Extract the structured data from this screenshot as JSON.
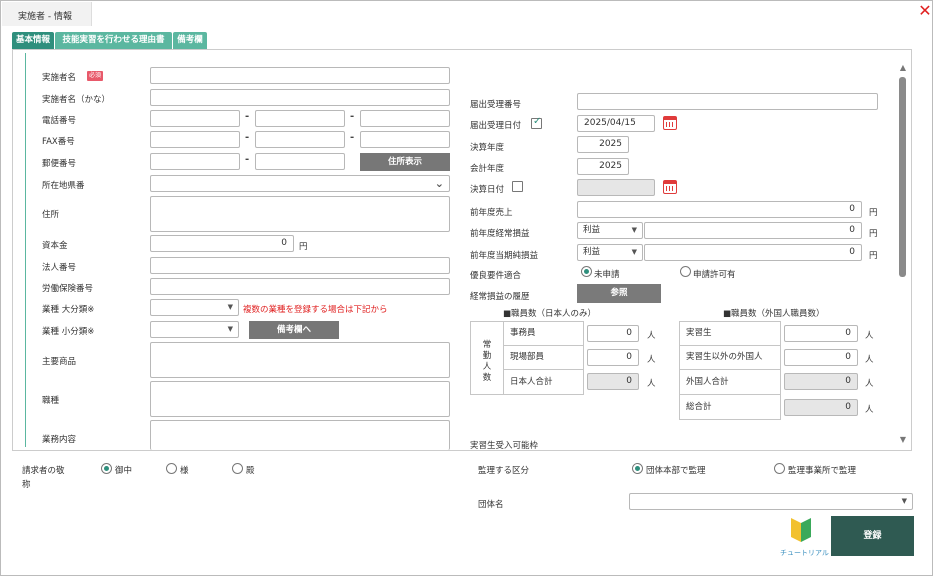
{
  "window": {
    "title": "実施者 - 情報",
    "close": "✕"
  },
  "tabs": [
    {
      "label": "基本情報"
    },
    {
      "label": "技能実習を行わせる理由書"
    },
    {
      "label": "備考欄"
    }
  ],
  "left": {
    "name_label": "実施者名",
    "required_badge": "必須",
    "kana_label": "実施者名（かな）",
    "phone_label": "電話番号",
    "fax_label": "FAX番号",
    "postal_label": "郵便番号",
    "dash": "-",
    "address_btn": "住所表示",
    "pref_label": "所在地県番",
    "address_label": "住所",
    "capital_label": "資本金",
    "capital_value": "0",
    "yen": "円",
    "corp_label": "法人番号",
    "insurance_label": "労働保険番号",
    "ind_major_label": "業種 大分類※",
    "ind_minor_label": "業種 小分類※",
    "warn_text": "複数の業種を登録する場合は下記から",
    "remarks_btn": "備考欄へ",
    "products_label": "主要商品",
    "job_label": "職種",
    "business_label": "業務内容"
  },
  "right": {
    "notif_no_label": "届出受理番号",
    "notif_date_label": "届出受理日付",
    "notif_date_checked": true,
    "notif_date_value": "2025/04/15",
    "fiscal_year_label": "決算年度",
    "fiscal_year_value": "2025",
    "account_year_label": "会計年度",
    "account_year_value": "2025",
    "settle_date_label": "決算日付",
    "settle_date_checked": false,
    "prev_sales_label": "前年度売上",
    "prev_sales_value": "0",
    "prev_ordinary_label": "前年度経常損益",
    "prev_ordinary_select": "利益",
    "prev_ordinary_value": "0",
    "prev_net_label": "前年度当期純損益",
    "prev_net_select": "利益",
    "prev_net_value": "0",
    "excellent_label": "優良要件適合",
    "excellent_opt1": "未申請",
    "excellent_opt2": "申請許可有",
    "history_label": "経常損益の履歴",
    "history_btn": "参照",
    "staff_title": "■職員数（日本人のみ）",
    "staff_side": "常勤人数",
    "staff_rows": [
      {
        "label": "事務員",
        "value": "0"
      },
      {
        "label": "現場部員",
        "value": "0"
      },
      {
        "label": "日本人合計",
        "value": "0"
      }
    ],
    "person_unit": "人",
    "foreign_title": "■職員数（外国人職員数）",
    "foreign_rows": [
      {
        "label": "実習生",
        "value": "0"
      },
      {
        "label": "実習生以外の外国人",
        "value": "0"
      },
      {
        "label": "外国人合計",
        "value": "0"
      },
      {
        "label": "総合計",
        "value": "0"
      }
    ],
    "intake_label": "実習生受入可能枠"
  },
  "bottom": {
    "honorific_label_1": "請求者の敬",
    "honorific_label_2": "称",
    "hon_opt1": "御中",
    "hon_opt2": "様",
    "hon_opt3": "殿",
    "supervise_label": "監理する区分",
    "sup_opt1": "団体本部で監理",
    "sup_opt2": "監理事業所で監理",
    "org_label": "団体名",
    "tutorial_label": "チュートリアル",
    "register_btn": "登録"
  },
  "colors": {
    "accent": "#2f8f7d",
    "tab": "#5bb7a0",
    "warning": "#e02020",
    "button": "#777777",
    "register": "#2f5a52"
  }
}
